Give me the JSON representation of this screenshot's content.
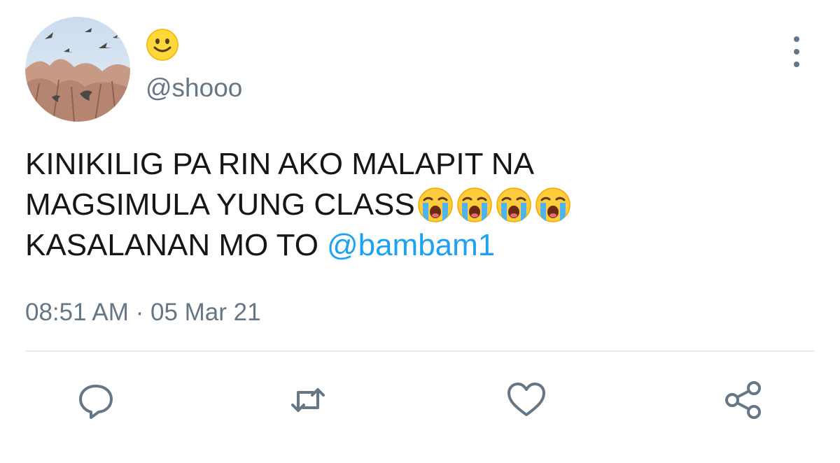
{
  "author": {
    "display_name_icon": "slightly-smiling-face-emoji",
    "handle": "@shooo",
    "avatar": "birds-over-trees-photo"
  },
  "tweet": {
    "line1": "KINIKILIG PA RIN AKO MALAPIT NA",
    "line2": "MAGSIMULA YUNG CLASS",
    "line2_emoji": [
      "loudly-crying-face-emoji",
      "loudly-crying-face-emoji",
      "loudly-crying-face-emoji",
      "loudly-crying-face-emoji"
    ],
    "line3": "KASALANAN MO TO",
    "mention": "@bambam1",
    "timestamp": "08:51 AM · 05 Mar 21"
  },
  "actions": [
    "reply-icon",
    "retweet-icon",
    "like-icon",
    "share-icon"
  ],
  "colors": {
    "text": "#14171a",
    "secondary": "#657786",
    "link": "#1da1f2",
    "divider": "#e6ecf0"
  }
}
